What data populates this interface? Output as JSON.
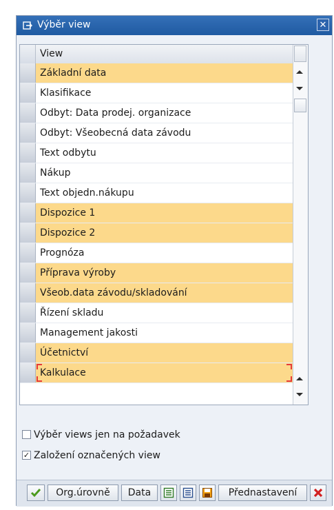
{
  "dialog": {
    "title": "Výběr view"
  },
  "table": {
    "header": "View",
    "rows": [
      {
        "label": "Základní data",
        "selected": true
      },
      {
        "label": "Klasifikace",
        "selected": false
      },
      {
        "label": "Odbyt: Data prodej. organizace",
        "selected": false
      },
      {
        "label": "Odbyt: Všeobecná data závodu",
        "selected": false
      },
      {
        "label": "Text odbytu",
        "selected": false
      },
      {
        "label": "Nákup",
        "selected": false
      },
      {
        "label": "Text objedn.nákupu",
        "selected": false
      },
      {
        "label": "Dispozice 1",
        "selected": true
      },
      {
        "label": "Dispozice 2",
        "selected": true
      },
      {
        "label": "Prognóza",
        "selected": false
      },
      {
        "label": "Příprava výroby",
        "selected": true
      },
      {
        "label": "Všeob.data závodu/skladování",
        "selected": true
      },
      {
        "label": "Řízení skladu",
        "selected": false
      },
      {
        "label": "Management jakosti",
        "selected": false
      },
      {
        "label": "Účetnictví",
        "selected": true
      },
      {
        "label": "Kalkulace",
        "selected": true
      }
    ]
  },
  "options": {
    "views_on_demand": {
      "label": "Výběr views jen na požadavek",
      "checked": false
    },
    "create_selected": {
      "label": "Založení označených view",
      "checked": true
    }
  },
  "buttons": {
    "org_levels": "Org.úrovně",
    "data": "Data",
    "default_values": "Přednastavení"
  },
  "colors": {
    "selected_row": "#fcd98b",
    "title_bar": "#2b63ad"
  }
}
